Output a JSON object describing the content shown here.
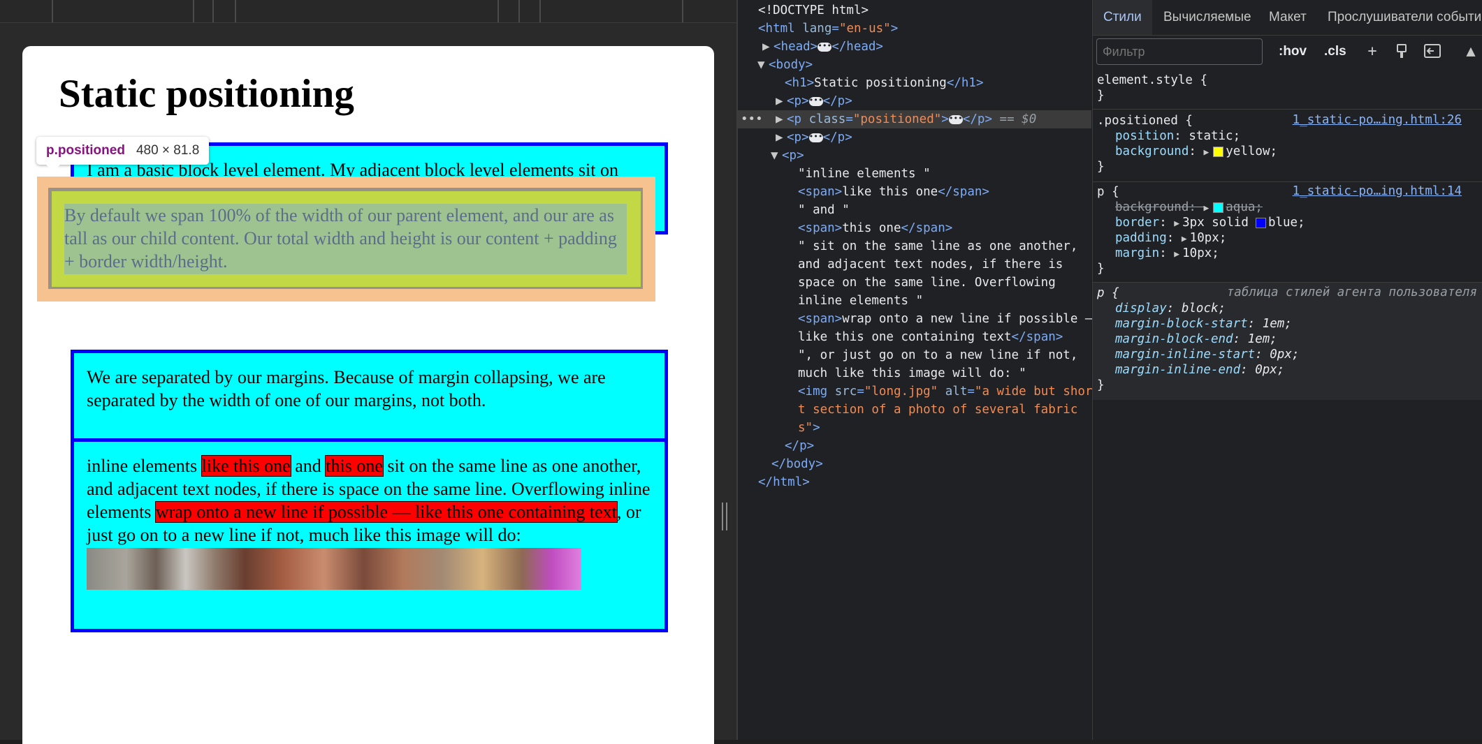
{
  "page": {
    "h1": "Static positioning",
    "p1": "I am a basic block level element. My adjacent block level elements sit on new lines below me.",
    "p2": "By default we span 100% of the width of our parent element, and our are as tall as our child content. Our total width and height is our content + padding + border width/height.",
    "p3": "We are separated by our margins. Because of margin collapsing, we are separated by the width of one of our margins, not both.",
    "p4": {
      "t1": "inline elements ",
      "s1": "like this one",
      "t2": " and ",
      "s2": "this one",
      "t3": " sit on the same line as one another, and adjacent text nodes, if there is space on the same line. Overflowing inline elements ",
      "s3": "wrap onto a new line if possible — like this one containing text",
      "t4": ", or just go on to a new line if not, much like this image will do:",
      "img_alt": "a wide but short section of a photo of several fabrics"
    }
  },
  "tooltip": {
    "tag": "p.positioned",
    "dims": "480 × 81.8"
  },
  "elements": {
    "doctype": "<!DOCTYPE html>",
    "html_open_tag": "<html",
    "html_lang_attr": "lang",
    "html_lang_val": "\"en-us\"",
    "head_open": "<head>",
    "head_close": "</head>",
    "body_open": "<body>",
    "h1_open": "<h1>",
    "h1_text": "Static positioning",
    "h1_close": "</h1>",
    "p_open": "<p>",
    "p_close": "</p>",
    "p_class_tag": "<p",
    "p_class_attr": "class",
    "p_class_val": "\"positioned\"",
    "sel_marker": "== $0",
    "text1": "\"inline elements \"",
    "span_open": "<span>",
    "span_close": "</span>",
    "span1_text": "like this one",
    "text2": "\" and \"",
    "span2_text": "this one",
    "text3a": "\" sit on the same line as one another,",
    "text3b": "and adjacent text nodes, if there is",
    "text3c": "space on the same line. Overflowing",
    "text3d": "inline elements \"",
    "span3_a": "wrap onto a new line if possible —",
    "span3_b": "like this one containing text",
    "text4a": "\", or just go on to a new line if not,",
    "text4b": "much like this image will do: \"",
    "img_tag": "<img",
    "img_src_attr": "src",
    "img_src_val": "\"long.jpg\"",
    "img_alt_attr": "alt",
    "img_alt_val_a": "\"a wide but shor",
    "img_alt_val_b": "t section of a photo of several fabric",
    "img_alt_val_c": "s\"",
    "img_close": ">",
    "body_close": "</body>",
    "html_close": "</html>"
  },
  "styles": {
    "tabs": [
      "Стили",
      "Вычисляемые",
      "Макет",
      "Прослушиватели событий"
    ],
    "filter_placeholder": "Фильтр",
    "hov": ":hov",
    "cls": ".cls",
    "element_style": "element.style {",
    "close_brace": "}",
    "rule1": {
      "selector": ".positioned {",
      "source": "1_static-po…ing.html:26",
      "position_prop": "position",
      "position_val": "static;",
      "background_prop": "background",
      "background_val": "yellow;",
      "swatch": "#ffff00"
    },
    "rule2": {
      "selector": "p {",
      "source": "1_static-po…ing.html:14",
      "bg_prop": "background",
      "bg_val": "aqua;",
      "bg_swatch": "#00ffff",
      "border_prop": "border",
      "border_val_a": "3px solid",
      "border_swatch": "#0000ff",
      "border_val_b": "blue;",
      "padding_prop": "padding",
      "padding_val": "10px;",
      "margin_prop": "margin",
      "margin_val": "10px;"
    },
    "rule3": {
      "selector": "p {",
      "label": "таблица стилей агента пользователя",
      "display_prop": "display",
      "display_val": "block;",
      "mbs_prop": "margin-block-start",
      "mbs_val": "1em;",
      "mbe_prop": "margin-block-end",
      "mbe_val": "1em;",
      "mis_prop": "margin-inline-start",
      "mis_val": "0px;",
      "mie_prop": "margin-inline-end",
      "mie_val": "0px;"
    }
  }
}
